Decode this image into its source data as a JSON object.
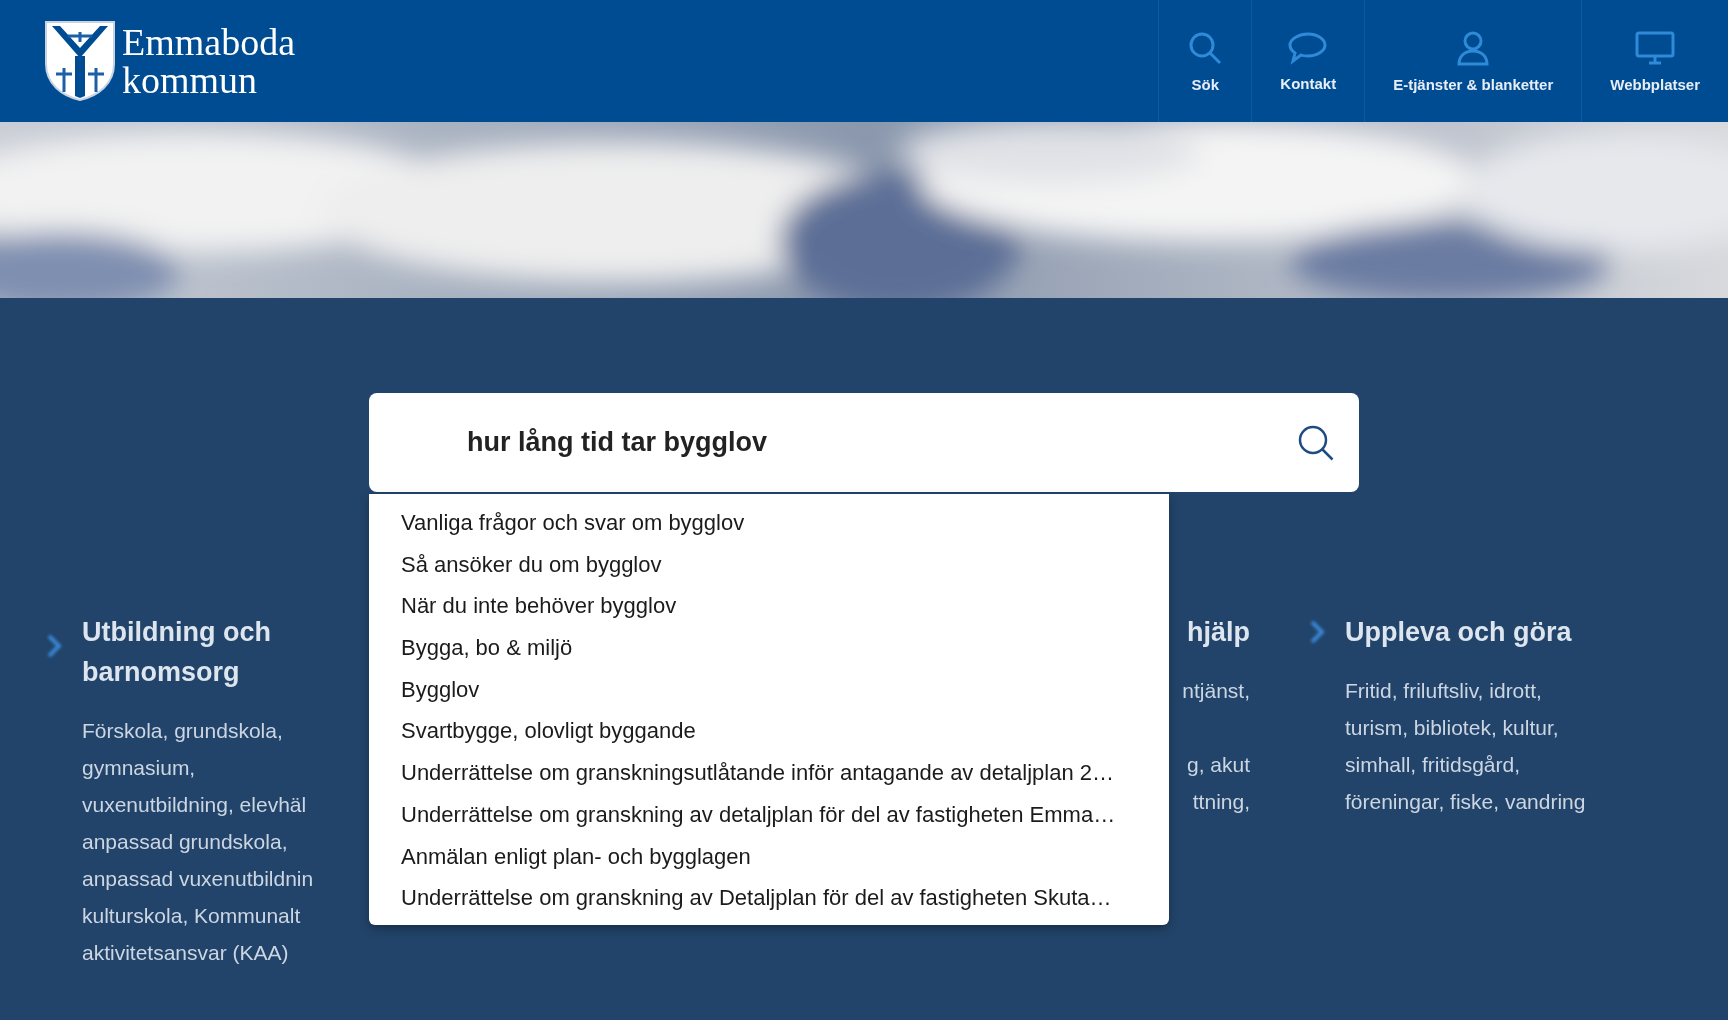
{
  "header": {
    "logo_lines": [
      "Emmaboda",
      "kommun"
    ],
    "nav": [
      {
        "label": "Sök"
      },
      {
        "label": "Kontakt"
      },
      {
        "label": "E-tjänster & blanketter"
      },
      {
        "label": "Webbplatser"
      }
    ]
  },
  "search": {
    "value": "hur lång tid tar bygglov"
  },
  "suggestions": [
    "Vanliga frågor och svar om bygglov",
    "Så ansöker du om bygglov",
    "När du inte behöver bygglov",
    "Bygga, bo & miljö",
    "Bygglov",
    "Svartbygge, olovligt byggande",
    "Underrättelse om granskningsutlåtande inför antagande av detaljplan 2…",
    "Underrättelse om granskning av detaljplan för del av fastigheten Emma…",
    "Anmälan enligt plan- och bygglagen",
    "Underrättelse om granskning av Detaljplan för del av fastigheten Skuta…"
  ],
  "categories": [
    {
      "title": "Utbildning och barnomsorg",
      "lines": [
        "Förskola, grundskola,",
        "gymnasium,",
        "vuxenutbildning, elevhäl",
        "anpassad grundskola,",
        "anpassad vuxenutbildnin",
        "kulturskola, Kommunalt",
        "aktivitetsansvar (KAA)"
      ]
    },
    {
      "title": "hjälp",
      "lines": [
        "ntjänst,",
        "g, akut",
        "ttning,"
      ]
    },
    {
      "title": "Uppleva och göra",
      "lines": [
        "Fritid, friluftsliv, idrott,",
        "turism, bibliotek, kultur,",
        "simhall, fritidsgård,",
        "föreningar, fiske, vandring"
      ]
    }
  ]
}
